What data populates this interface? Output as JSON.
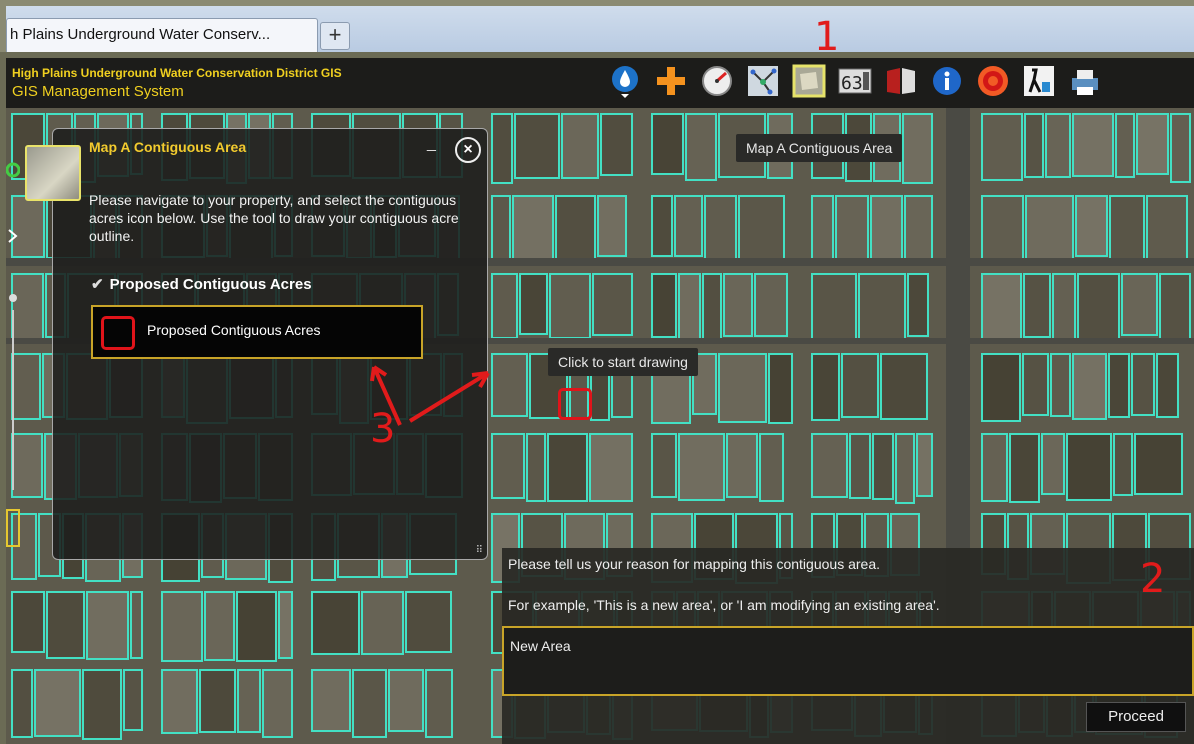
{
  "browser": {
    "tab_title": "h Plains Underground Water Conserv...",
    "new_tab": "+"
  },
  "header": {
    "title": "High Plains Underground Water Conservation District GIS",
    "subtitle": "GIS Management System",
    "tools": [
      {
        "name": "water-drop-icon"
      },
      {
        "name": "plus-icon"
      },
      {
        "name": "gauge-icon"
      },
      {
        "name": "network-icon"
      },
      {
        "name": "map-contiguous-area-icon"
      },
      {
        "name": "meter-counter-icon"
      },
      {
        "name": "book-icon"
      },
      {
        "name": "info-icon"
      },
      {
        "name": "target-icon"
      },
      {
        "name": "measure-icon"
      },
      {
        "name": "print-icon"
      }
    ],
    "title_color": "#f0d020"
  },
  "tooltips": {
    "tool": "Map A Contiguous Area",
    "draw": "Click to start drawing"
  },
  "panel": {
    "title": "Map A Contiguous Area",
    "minimize": "_",
    "close": "×",
    "instructions": "Please navigate to your property, and select the contiguous acres icon below.  Use the tool to draw your contiguous acre outline.",
    "layer_label": "Proposed Contiguous Acres",
    "draw_button_label": "Proposed Contiguous Acres",
    "resize": "⠿"
  },
  "reason": {
    "question": "Please tell us your reason for mapping this contiguous area.",
    "example": "For example, 'This is a new area', or 'I am modifying an existing area'.",
    "value": "New Area",
    "proceed_label": "Proceed"
  },
  "annotations": {
    "one": "1",
    "two": "2",
    "three": "3"
  },
  "colors": {
    "accent": "#f2cb2e",
    "parcel": "#43e0c4",
    "annotation": "#e11b1b"
  }
}
